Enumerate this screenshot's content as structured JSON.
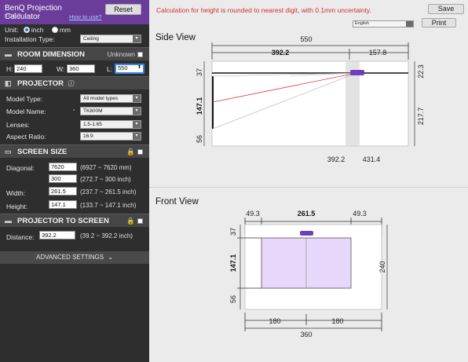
{
  "header": {
    "app_title": "BenQ Projection Calculator",
    "version": "v.0.9.3",
    "howto_link": "How to use?",
    "reset_label": "Reset"
  },
  "unit": {
    "label": "Unit:",
    "options": [
      "inch",
      "mm"
    ],
    "selected": "inch"
  },
  "installation": {
    "label": "Installation Type:",
    "value": "Ceiling"
  },
  "room": {
    "title": "ROOM DIMENSION",
    "unknown_label": "Unknown",
    "h_label": "H:",
    "h_value": "240",
    "w_label": "W:",
    "w_value": "360",
    "l_label": "L:",
    "l_value": "550"
  },
  "projector": {
    "title": "PROJECTOR",
    "model_type_label": "Model Type:",
    "model_type_value": "All model types",
    "model_name_label": "Model Name:",
    "model_name_value": "TK800M",
    "lenses_label": "Lenses:",
    "lenses_value": "1.5-1.65",
    "aspect_label": "Aspect Ratio:",
    "aspect_value": "16:9"
  },
  "screen": {
    "title": "SCREEN SIZE",
    "diagonal_label": "Diagonal:",
    "diagonal_mm": "7620",
    "diagonal_mm_range": "(6927 ~ 7620 mm)",
    "diagonal_inch": "300",
    "diagonal_inch_range": "(272.7 ~ 300 inch)",
    "width_label": "Width:",
    "width_value": "261.5",
    "width_range": "(237.7 ~ 261.5 inch)",
    "height_label": "Height:",
    "height_value": "147.1",
    "height_range": "(133.7 ~ 147.1 inch)"
  },
  "projector_to_screen": {
    "title": "PROJECTOR TO SCREEN",
    "distance_label": "Distance:",
    "distance_value": "392.2",
    "distance_range": "(39.2 ~ 392.2 inch)"
  },
  "advanced_label": "ADVANCED SETTINGS",
  "main": {
    "notice": "Calculation for height is rounded to nearest digit, with 0.1mm uncertainty.",
    "save_label": "Save",
    "print_label": "Print",
    "language": "English"
  },
  "side_view": {
    "title": "Side View",
    "total_length": "550",
    "distance_main": "392.2",
    "remainder": "157.8",
    "top_offset": "37",
    "screen_height": "147.1",
    "bottom_offset": "56",
    "right_top": "22.3",
    "right_height": "217.7",
    "bottom_left": "392.2",
    "bottom_right": "431.4"
  },
  "front_view": {
    "title": "Front View",
    "left_margin": "49.3",
    "screen_width": "261.5",
    "right_margin": "49.3",
    "top_offset": "37",
    "screen_height": "147.1",
    "bottom_offset": "56",
    "room_height": "240",
    "half_left": "180",
    "half_right": "180",
    "room_width": "360"
  },
  "colors": {
    "brand_purple": "#6a3d9a",
    "projector_purple": "#6d3fc0",
    "screen_fill": "#e6d7fb",
    "beam_red": "#d93b3b",
    "notice_red": "#cc3333"
  }
}
